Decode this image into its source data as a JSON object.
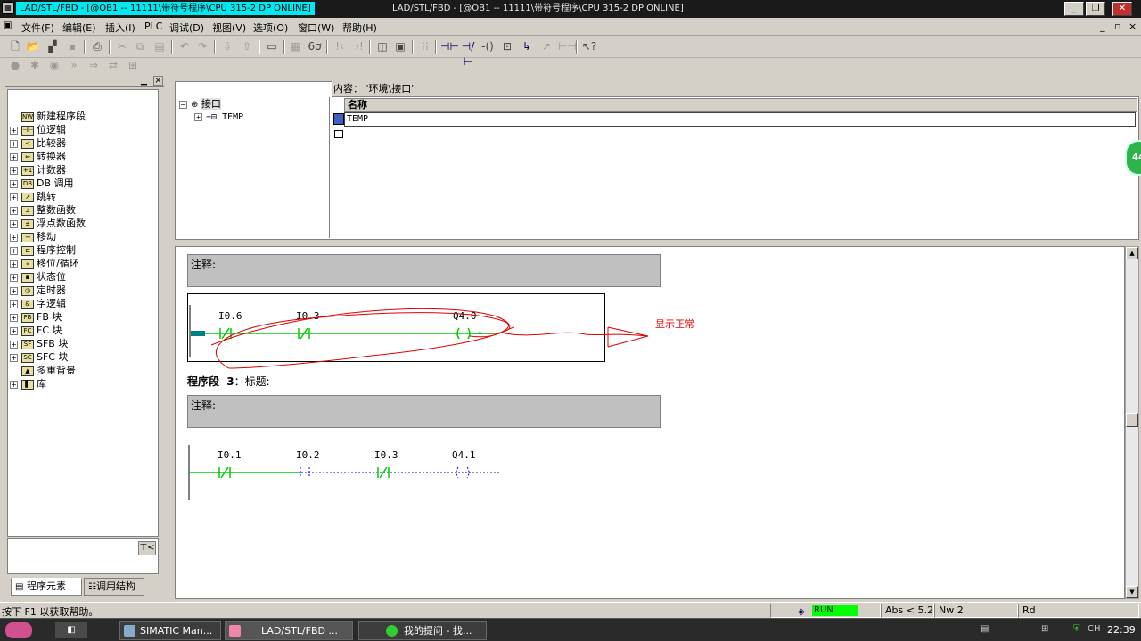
{
  "window": {
    "title_left": "LAD/STL/FBD  - [@OB1 -- 11111\\带符号程序\\CPU 315-2 DP  ONLINE]",
    "title_center": "LAD/STL/FBD  - [@OB1 -- 11111\\带符号程序\\CPU 315-2 DP  ONLINE]",
    "min_label": "_",
    "max_label": "❐",
    "close_label": "✕"
  },
  "menu": [
    "文件(F)",
    "编辑(E)",
    "插入(I)",
    "PLC",
    "调试(D)",
    "视图(V)",
    "选项(O)",
    "窗口(W)",
    "帮助(H)"
  ],
  "mdi_controls": [
    "_",
    "▫",
    "×"
  ],
  "toolbar": {
    "icons": [
      "new-icon",
      "open-icon",
      "accessible-nodes-icon",
      "save-icon",
      "print-icon",
      "cut-icon",
      "copy-icon",
      "paste-icon",
      "undo-icon",
      "redo-icon",
      "download-icon",
      "upload-icon",
      "monitor-icon",
      "glasses-icon",
      "overview-icon",
      "detail-icon",
      "open-contact-icon",
      "closed-contact-icon",
      "coil-icon",
      "box-icon",
      "branch-open-icon",
      "branch-close-icon",
      "connection-icon",
      "help-icon"
    ]
  },
  "program_elements": {
    "title": "程序元素",
    "items": [
      {
        "label": "新建程序段",
        "icon": "NW",
        "expandable": false
      },
      {
        "label": "位逻辑",
        "icon": "⊣⊢",
        "expandable": true
      },
      {
        "label": "比较器",
        "icon": "<",
        "expandable": true
      },
      {
        "label": "转换器",
        "icon": "⇔",
        "expandable": true
      },
      {
        "label": "计数器",
        "icon": "+1",
        "expandable": true
      },
      {
        "label": "DB 调用",
        "icon": "DB",
        "expandable": true
      },
      {
        "label": "跳转",
        "icon": "↗",
        "expandable": true
      },
      {
        "label": "整数函数",
        "icon": "±",
        "expandable": true
      },
      {
        "label": "浮点数函数",
        "icon": "±",
        "expandable": true
      },
      {
        "label": "移动",
        "icon": "→",
        "expandable": true
      },
      {
        "label": "程序控制",
        "icon": "⊏",
        "expandable": true
      },
      {
        "label": "移位/循环",
        "icon": "«",
        "expandable": true
      },
      {
        "label": "状态位",
        "icon": "▪",
        "expandable": true
      },
      {
        "label": "定时器",
        "icon": "◷",
        "expandable": true
      },
      {
        "label": "字逻辑",
        "icon": "&",
        "expandable": true
      },
      {
        "label": "FB 块",
        "icon": "FB",
        "expandable": true
      },
      {
        "label": "FC 块",
        "icon": "FC",
        "expandable": true
      },
      {
        "label": "SFB 块",
        "icon": "SF",
        "expandable": true
      },
      {
        "label": "SFC 块",
        "icon": "SC",
        "expandable": true
      },
      {
        "label": "多重背景",
        "icon": "▲",
        "expandable": false
      },
      {
        "label": "库",
        "icon": "▌",
        "expandable": true
      }
    ],
    "bottom_btn": "⊤<",
    "tab1": "程序元素",
    "tab2": "调用结构"
  },
  "interface": {
    "content_label": "内容：  '环境\\接口'",
    "tree_root": "接口",
    "tree_child": "TEMP",
    "col_name": "名称",
    "row1": "TEMP"
  },
  "code": {
    "comment1": "注释:",
    "network2": {
      "contacts": [
        "I0.6",
        "I0.3"
      ],
      "coil": "Q4.0",
      "annotation": "显示正常"
    },
    "seg3_prefix": "程序段",
    "seg3_num": "3",
    "seg3_title": "：标题:",
    "comment3": "注释:",
    "network3": {
      "contacts": [
        "I0.1",
        "I0.2",
        "I0.3"
      ],
      "coil": "Q4.1"
    }
  },
  "statusbar": {
    "help": "按下 F1 以获取帮助。",
    "run": "RUN",
    "abs": "Abs < 5.2",
    "nw": "Nw 2",
    "rd": "Rd"
  },
  "taskbar": {
    "tasks": [
      "SIMATIC Man...",
      "LAD/STL/FBD ...",
      "我的提问 - 找..."
    ],
    "clock": "22:39",
    "bubble": "44"
  },
  "colors": {
    "energized": "#00cc00",
    "unpowered": "#0000ff",
    "annotation": "#ff0000",
    "run": "#00ff00"
  }
}
